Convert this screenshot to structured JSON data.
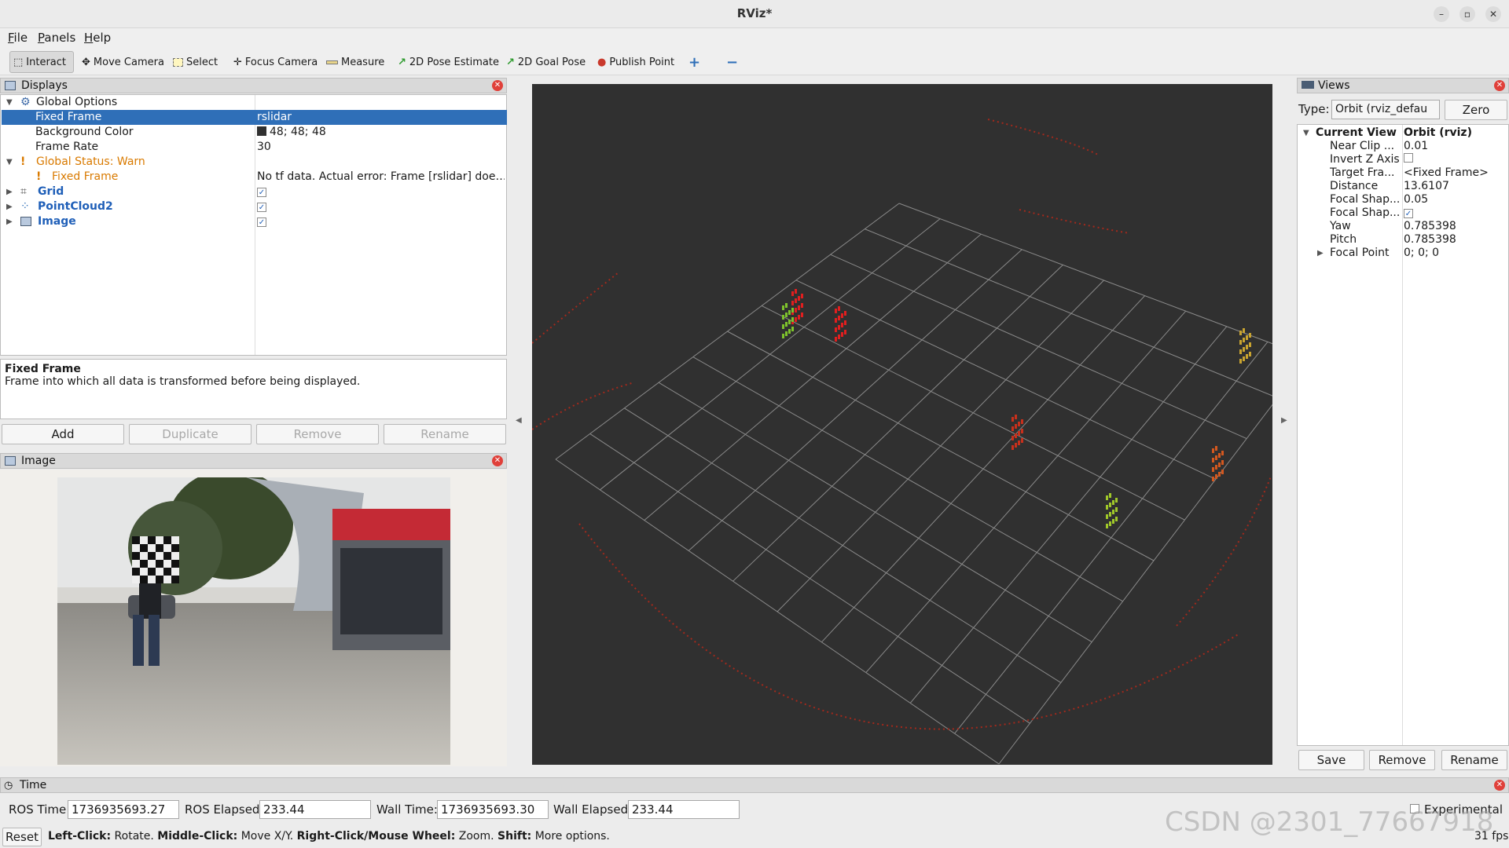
{
  "window": {
    "title": "RViz*",
    "minimize": "–",
    "maximize": "▫",
    "close": "✕"
  },
  "menu": [
    "File",
    "Panels",
    "Help"
  ],
  "toolbar": {
    "interact": "Interact",
    "move_camera": "Move Camera",
    "select": "Select",
    "focus_camera": "Focus Camera",
    "measure": "Measure",
    "pose_estimate": "2D Pose Estimate",
    "goal_pose": "2D Goal Pose",
    "publish_point": "Publish Point",
    "add_tool": "+",
    "remove_tool": "−"
  },
  "displays": {
    "title": "Displays",
    "global_options": "Global Options",
    "fixed_frame": {
      "label": "Fixed Frame",
      "value": "rslidar"
    },
    "background_color": {
      "label": "Background Color",
      "value": "48; 48; 48",
      "swatch": "#303030"
    },
    "frame_rate": {
      "label": "Frame Rate",
      "value": "30"
    },
    "global_status": "Global Status: Warn",
    "status_fixed_frame": {
      "label": "Fixed Frame",
      "value": "No tf data.  Actual error: Frame [rslidar] doe…"
    },
    "grid": {
      "label": "Grid",
      "checked": "✓"
    },
    "pointcloud": {
      "label": "PointCloud2",
      "checked": "✓"
    },
    "image": {
      "label": "Image",
      "checked": "✓"
    }
  },
  "description": {
    "title": "Fixed Frame",
    "text": "Frame into which all data is transformed before being displayed."
  },
  "display_buttons": {
    "add": "Add",
    "duplicate": "Duplicate",
    "remove": "Remove",
    "rename": "Rename"
  },
  "image_panel": {
    "title": "Image"
  },
  "views": {
    "title": "Views",
    "type_label": "Type:",
    "type_value": "Orbit (rviz_defau",
    "zero": "Zero",
    "current_view": {
      "label": "Current View",
      "value": "Orbit (rviz)"
    },
    "props": [
      {
        "k": "Near Clip ...",
        "v": "0.01"
      },
      {
        "k": "Invert Z Axis",
        "v": ""
      },
      {
        "k": "Target Fra...",
        "v": "<Fixed Frame>"
      },
      {
        "k": "Distance",
        "v": "13.6107"
      },
      {
        "k": "Focal Shap...",
        "v": "0.05"
      },
      {
        "k": "Focal Shap...",
        "v": "✓"
      },
      {
        "k": "Yaw",
        "v": "0.785398"
      },
      {
        "k": "Pitch",
        "v": "0.785398"
      },
      {
        "k": "Focal Point",
        "v": "0; 0; 0"
      }
    ],
    "save": "Save",
    "remove": "Remove",
    "rename": "Rename"
  },
  "time": {
    "title": "Time",
    "ros_time_label": "ROS Time:",
    "ros_time": "1736935693.27",
    "ros_elapsed_label": "ROS Elapsed:",
    "ros_elapsed": "233.44",
    "wall_time_label": "Wall Time:",
    "wall_time": "1736935693.30",
    "wall_elapsed_label": "Wall Elapsed:",
    "wall_elapsed": "233.44",
    "experimental": "Experimental"
  },
  "status_bar": {
    "reset": "Reset",
    "b1": "Left-Click:",
    "t1": " Rotate. ",
    "b2": "Middle-Click:",
    "t2": " Move X/Y. ",
    "b3": "Right-Click/Mouse Wheel:",
    "t3": " Zoom. ",
    "b4": "Shift:",
    "t4": " More options.",
    "fps": "31 fps"
  },
  "watermark": "CSDN @2301_77667918"
}
